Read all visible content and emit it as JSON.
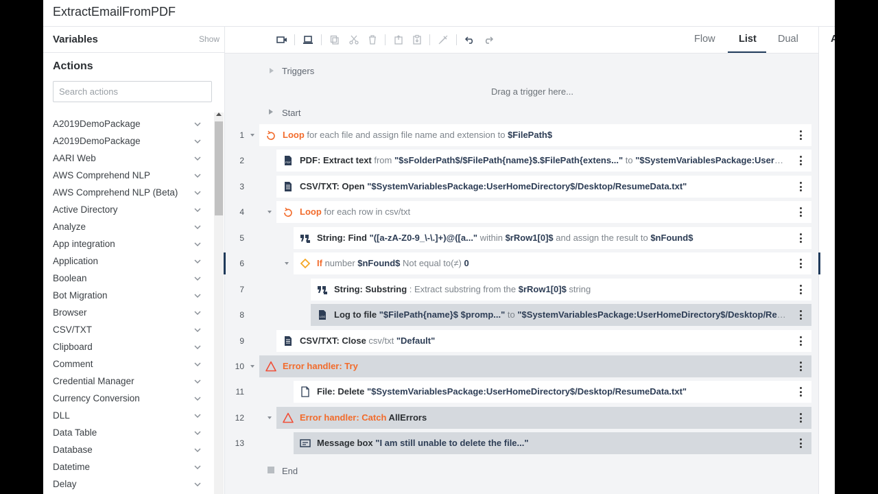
{
  "app": {
    "title": "ExtractEmailFromPDF"
  },
  "left_panel": {
    "variables_label": "Variables",
    "show_label": "Show",
    "actions_label": "Actions",
    "search_placeholder": "Search actions",
    "packages": [
      "A2019DemoPackage",
      "A2019DemoPackage",
      "AARI Web",
      "AWS Comprehend NLP",
      "AWS Comprehend NLP (Beta)",
      "Active Directory",
      "Analyze",
      "App integration",
      "Application",
      "Boolean",
      "Bot Migration",
      "Browser",
      "CSV/TXT",
      "Clipboard",
      "Comment",
      "Credential Manager",
      "Currency Conversion",
      "DLL",
      "Data Table",
      "Database",
      "Datetime",
      "Delay"
    ]
  },
  "toolbar": {
    "icons": [
      "record-icon",
      "laptop-icon",
      "copy-icon",
      "cut-icon",
      "delete-icon",
      "paste-above-icon",
      "paste-below-icon",
      "disable-icon",
      "undo-icon",
      "redo-icon"
    ],
    "tabs": [
      "Flow",
      "List",
      "Dual"
    ],
    "active_tab": "List"
  },
  "right_panel": {
    "label": "A"
  },
  "canvas": {
    "triggers_label": "Triggers",
    "drag_hint": "Drag a trigger here...",
    "start_label": "Start",
    "end_label": "End",
    "steps": [
      {
        "num": "1",
        "icon": "loop-icon",
        "parts": [
          [
            "Loop",
            "orange"
          ],
          [
            " for each file and assign file name and extension to ",
            ""
          ],
          [
            "$FilePath$",
            "var"
          ]
        ]
      },
      {
        "num": "2",
        "icon": "pdf-file-icon",
        "parts": [
          [
            "PDF: Extract text",
            "bold"
          ],
          [
            " from ",
            ""
          ],
          [
            "\"$sFolderPath$/$FilePath{name}$.$FilePath{extens...\"",
            "val"
          ],
          [
            " to ",
            ""
          ],
          [
            "\"$SystemVariablesPackage:UserHomeDirectory$/Desktop/ResumeData.txt\"",
            "val"
          ]
        ]
      },
      {
        "num": "3",
        "icon": "csv-file-icon",
        "parts": [
          [
            "CSV/TXT: Open",
            "bold"
          ],
          [
            " ",
            ""
          ],
          [
            "\"$SystemVariablesPackage:UserHomeDirectory$/Desktop/ResumeData.txt\"",
            "val"
          ]
        ]
      },
      {
        "num": "4",
        "icon": "loop-icon",
        "parts": [
          [
            "Loop",
            "orange"
          ],
          [
            " for each row in csv/txt",
            ""
          ]
        ]
      },
      {
        "num": "5",
        "icon": "string-quote-icon",
        "parts": [
          [
            "String: Find",
            "bold"
          ],
          [
            " ",
            ""
          ],
          [
            "\"([a-zA-Z0-9_\\-\\.]+)@([a...\"",
            "val"
          ],
          [
            " within ",
            ""
          ],
          [
            "$rRow1[0]$",
            "var"
          ],
          [
            " and assign the result to ",
            ""
          ],
          [
            "$nFound$",
            "var"
          ]
        ]
      },
      {
        "num": "6",
        "icon": "if-diamond-icon",
        "parts": [
          [
            "If",
            "orange"
          ],
          [
            " number ",
            ""
          ],
          [
            "$nFound$",
            "var"
          ],
          [
            " Not equal to(≠) ",
            ""
          ],
          [
            "0",
            "var"
          ]
        ]
      },
      {
        "num": "7",
        "icon": "string-quote-icon",
        "parts": [
          [
            "String: Substring",
            "bold"
          ],
          [
            " : Extract substring from the ",
            ""
          ],
          [
            "$rRow1[0]$",
            "var"
          ],
          [
            " string",
            ""
          ]
        ]
      },
      {
        "num": "8",
        "icon": "log-file-icon",
        "parts": [
          [
            "Log to file",
            "bold"
          ],
          [
            " ",
            ""
          ],
          [
            "\"$FilePath{name}$ $promp...\"",
            "val"
          ],
          [
            " to ",
            ""
          ],
          [
            "\"$SystemVariablesPackage:UserHomeDirectory$/Desktop/ResumeData.txt\"",
            "val"
          ]
        ]
      },
      {
        "num": "9",
        "icon": "csv-file-icon",
        "parts": [
          [
            "CSV/TXT: Close",
            "bold"
          ],
          [
            " csv/txt ",
            ""
          ],
          [
            "\"Default\"",
            "val"
          ]
        ]
      },
      {
        "num": "10",
        "icon": "error-triangle-icon",
        "parts": [
          [
            "Error handler: Try",
            "orange"
          ]
        ]
      },
      {
        "num": "11",
        "icon": "file-icon",
        "parts": [
          [
            "File: Delete",
            "bold"
          ],
          [
            " ",
            ""
          ],
          [
            "\"$SystemVariablesPackage:UserHomeDirectory$/Desktop/ResumeData.txt\"",
            "val"
          ]
        ]
      },
      {
        "num": "12",
        "icon": "error-triangle-icon",
        "parts": [
          [
            "Error handler: Catch",
            "orange"
          ],
          [
            " AllErrors",
            "bold"
          ]
        ]
      },
      {
        "num": "13",
        "icon": "message-box-icon",
        "parts": [
          [
            "Message box",
            "bold"
          ],
          [
            " ",
            ""
          ],
          [
            "\"I am still unable to delete the file...\"",
            "val"
          ]
        ]
      }
    ]
  }
}
